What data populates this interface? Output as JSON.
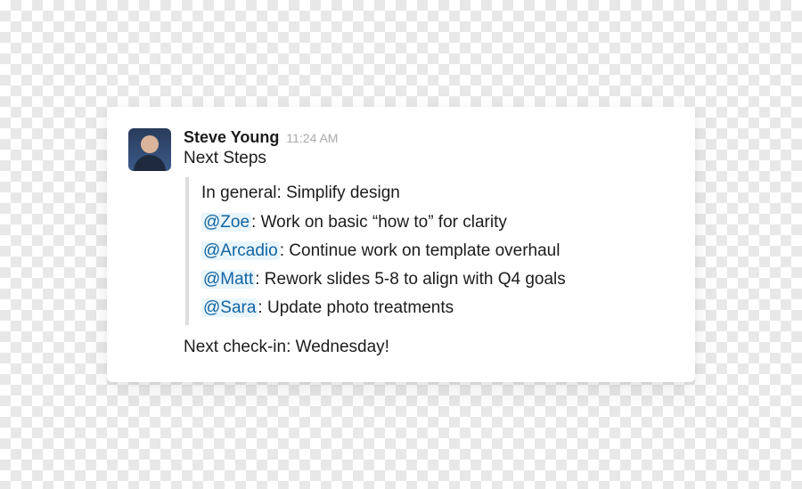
{
  "message": {
    "author": "Steve Young",
    "timestamp": "11:24 AM",
    "title": "Next Steps",
    "intro": "In general: Simplify design",
    "tasks": [
      {
        "mention": "@Zoe",
        "text": ": Work on basic “how to” for clarity"
      },
      {
        "mention": "@Arcadio",
        "text": ": Continue work on template overhaul"
      },
      {
        "mention": "@Matt",
        "text": ": Rework slides 5-8 to align with Q4 goals"
      },
      {
        "mention": "@Sara",
        "text": ": Update photo treatments"
      }
    ],
    "footer": "Next check-in: Wednesday!"
  }
}
